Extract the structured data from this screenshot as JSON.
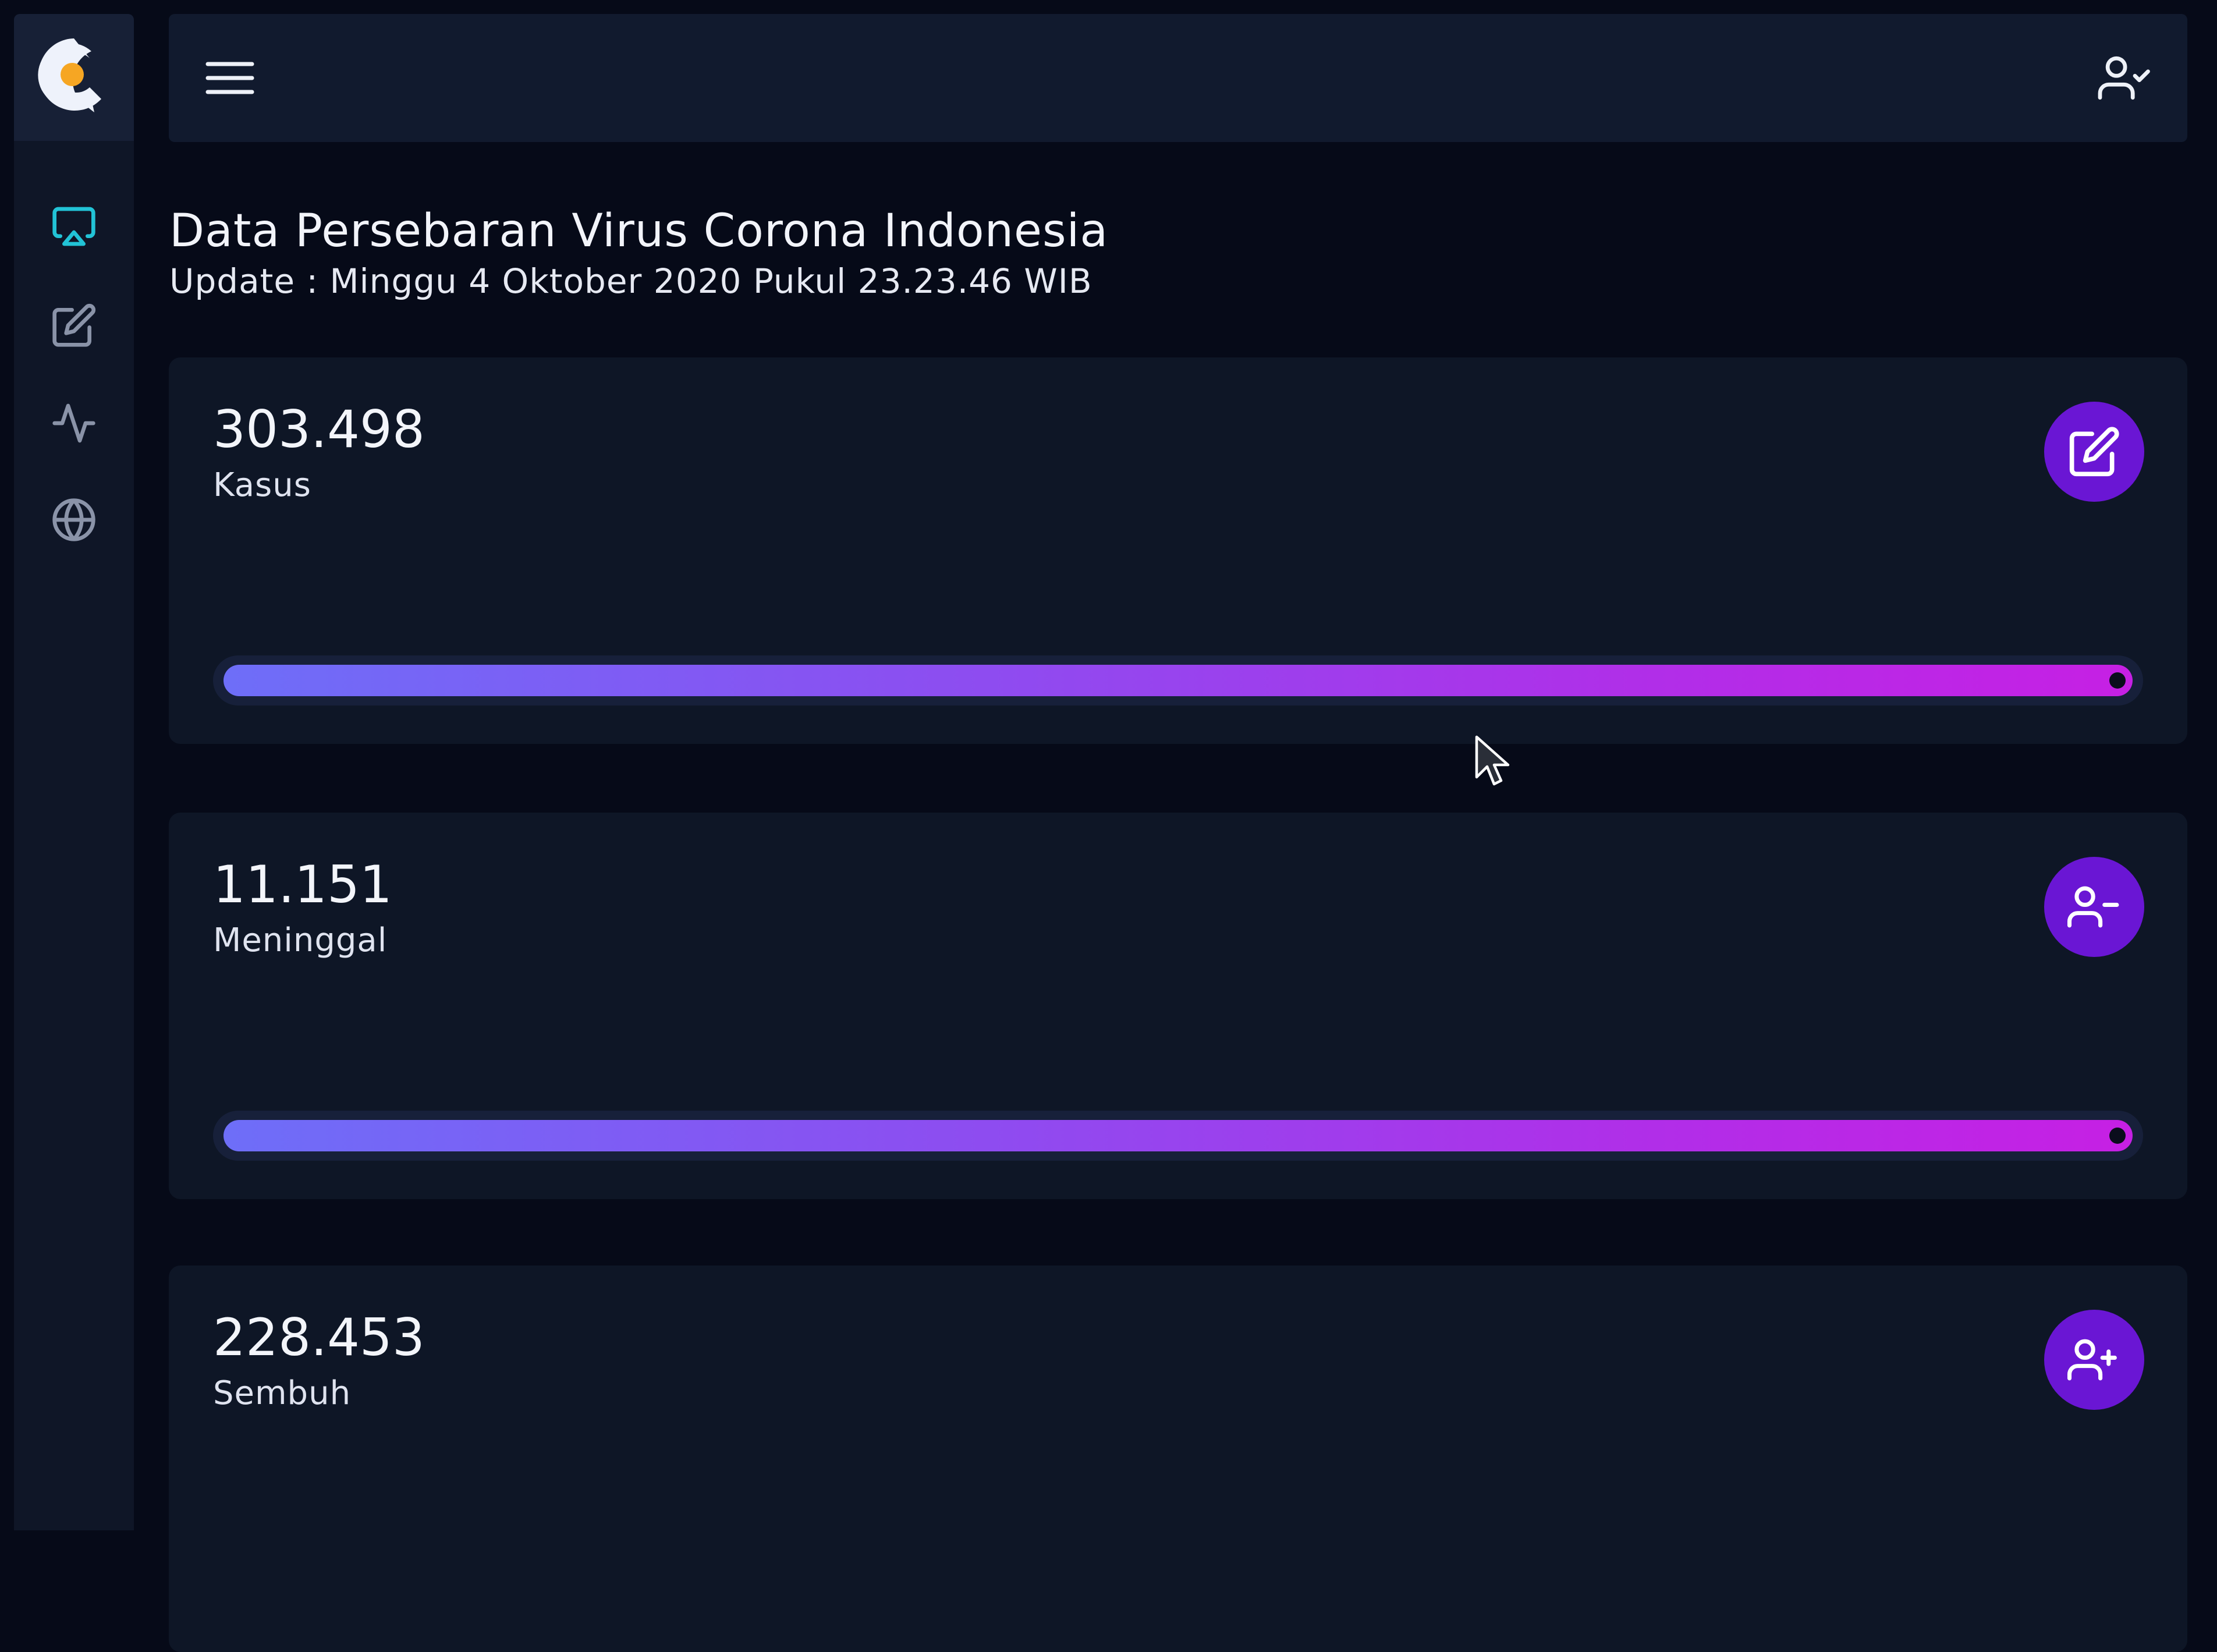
{
  "header": {
    "title": "Data Persebaran Virus Corona Indonesia",
    "update_text": "Update : Minggu 4 Oktober 2020 Pukul 23.23.46 WIB"
  },
  "sidebar": {
    "logo_icon": "c-logo-icon",
    "items": [
      {
        "icon": "monitor-icon",
        "active": true
      },
      {
        "icon": "edit-icon",
        "active": false
      },
      {
        "icon": "activity-icon",
        "active": false
      },
      {
        "icon": "globe-icon",
        "active": false
      }
    ]
  },
  "topbar": {
    "menu_icon": "hamburger-icon",
    "user_icon": "user-check-icon"
  },
  "stats": [
    {
      "value": "303.498",
      "label": "Kasus",
      "icon": "edit-icon",
      "progress": 1.0
    },
    {
      "value": "11.151",
      "label": "Meninggal",
      "icon": "user-minus-icon",
      "progress": 1.0
    },
    {
      "value": "228.453",
      "label": "Sembuh",
      "icon": "user-plus-icon"
    }
  ],
  "colors": {
    "background": "#060a18",
    "panel": "#0e1626",
    "accent": "#6a16d4",
    "active_nav": "#22c3d6",
    "logo_orange": "#f6a623"
  }
}
